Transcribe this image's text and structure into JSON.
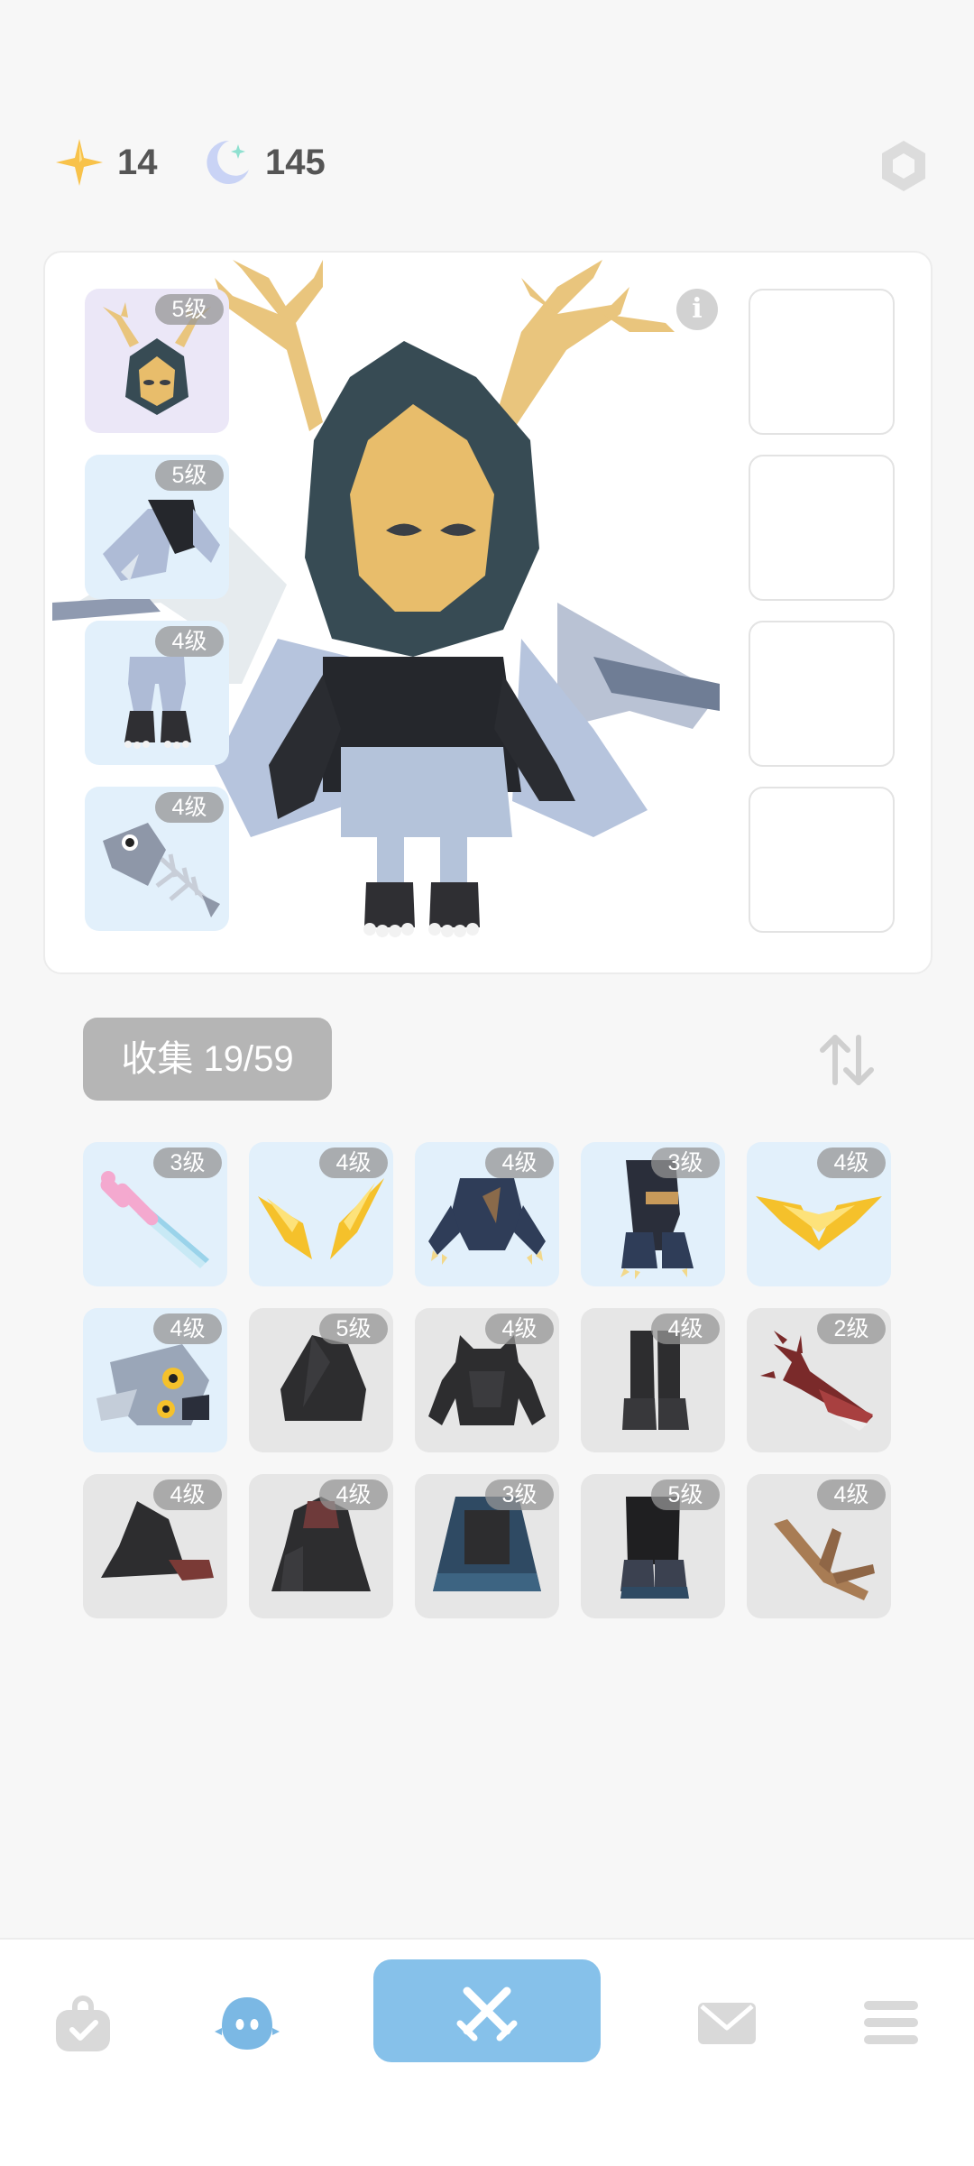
{
  "currency": {
    "stars": "14",
    "moons": "145"
  },
  "equipped": [
    {
      "slot": "head",
      "level": "5级"
    },
    {
      "slot": "body",
      "level": "5级"
    },
    {
      "slot": "legs",
      "level": "4级"
    },
    {
      "slot": "pet",
      "level": "4级"
    }
  ],
  "collection": {
    "label": "收集 19/59"
  },
  "items": [
    {
      "icon": "sword-icon",
      "level": "3级",
      "owned": true
    },
    {
      "icon": "golden-wings-icon",
      "level": "4级",
      "owned": true
    },
    {
      "icon": "dark-armor-icon",
      "level": "4级",
      "owned": true
    },
    {
      "icon": "dark-boots-icon",
      "level": "3级",
      "owned": true
    },
    {
      "icon": "golden-crest-icon",
      "level": "4级",
      "owned": true
    },
    {
      "icon": "fish-head-icon",
      "level": "4级",
      "owned": true
    },
    {
      "icon": "black-hood-icon",
      "level": "5级",
      "owned": false
    },
    {
      "icon": "spiked-armor-icon",
      "level": "4级",
      "owned": false
    },
    {
      "icon": "black-boots-icon",
      "level": "4级",
      "owned": false
    },
    {
      "icon": "red-blade-icon",
      "level": "2级",
      "owned": false
    },
    {
      "icon": "witch-hat-icon",
      "level": "4级",
      "owned": false
    },
    {
      "icon": "red-hooded-cloak-icon",
      "level": "4级",
      "owned": false
    },
    {
      "icon": "blue-cloak-icon",
      "level": "3级",
      "owned": false
    },
    {
      "icon": "armored-boots-icon",
      "level": "5级",
      "owned": false
    },
    {
      "icon": "branch-icon",
      "level": "4级",
      "owned": false
    }
  ],
  "nav": [
    {
      "icon": "bag-icon",
      "active": false
    },
    {
      "icon": "character-icon",
      "active": true
    },
    {
      "icon": "battle-swords-icon",
      "active": false
    },
    {
      "icon": "mail-icon",
      "active": false
    },
    {
      "icon": "menu-icon",
      "active": false
    }
  ],
  "colors": {
    "accent": "#86c1ea",
    "owned_bg": "#e2f0fb",
    "locked_bg": "#e6e6e6",
    "badge": "#969696"
  }
}
